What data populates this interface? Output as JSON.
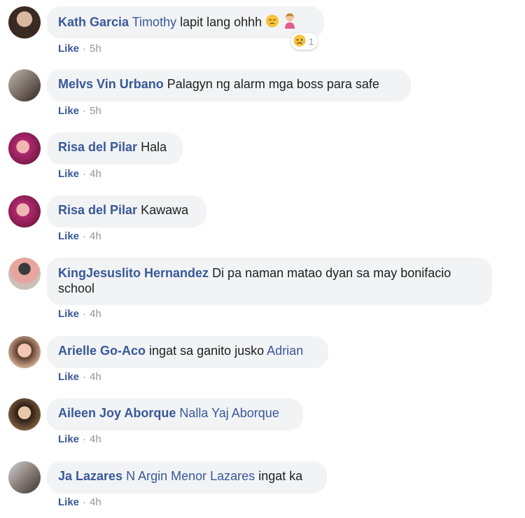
{
  "comments": [
    {
      "name": "Kath Garcia",
      "tag": "Timothy",
      "text": "lapit lang ohhh",
      "like": "Like",
      "time": "5h",
      "reaction_count": "1"
    },
    {
      "name": "Melvs Vin Urbano",
      "text": "Palagyn ng alarm mga boss para safe",
      "like": "Like",
      "time": "5h"
    },
    {
      "name": "Risa del Pilar",
      "text": "Hala",
      "like": "Like",
      "time": "4h"
    },
    {
      "name": "Risa del Pilar",
      "text": "Kawawa",
      "like": "Like",
      "time": "4h"
    },
    {
      "name": "KingJesuslito Hernandez",
      "text": "Di pa naman matao dyan sa may bonifacio",
      "text2": "school",
      "like": "Like",
      "time": "4h"
    },
    {
      "name": "Arielle Go-Aco",
      "text": "ingat sa ganito jusko",
      "tag": "Adrian",
      "like": "Like",
      "time": "4h"
    },
    {
      "name": "Aileen Joy Aborque",
      "tag": "Nalla Yaj Aborque",
      "like": "Like",
      "time": "4h"
    },
    {
      "name": "Ja Lazares",
      "tag": "N Argin Menor Lazares",
      "text": "ingat ka",
      "like": "Like",
      "time": "4h"
    }
  ],
  "dot": "·",
  "colors": {
    "link": "#385898",
    "bubble": "#f2f3f5",
    "meta": "#90949c"
  }
}
